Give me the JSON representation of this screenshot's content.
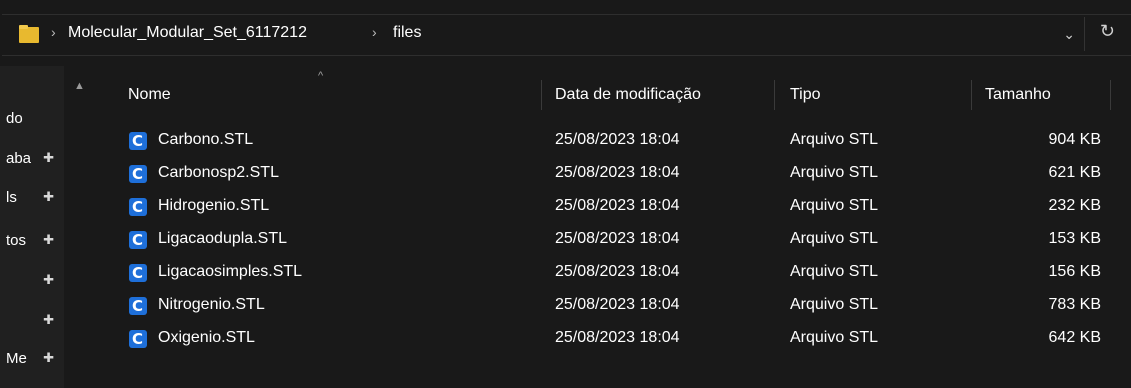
{
  "address_bar": {
    "crumbs": [
      "Molecular_Modular_Set_6117212",
      "files"
    ],
    "separator": "›",
    "dropdown_glyph": "⌄",
    "refresh_glyph": "↻"
  },
  "nav_pane": {
    "items": [
      {
        "label": "do",
        "pinned": false
      },
      {
        "label": "aba",
        "pinned": true
      },
      {
        "label": "ls",
        "pinned": true
      },
      {
        "label": "tos",
        "pinned": true
      },
      {
        "label": "",
        "pinned": true
      },
      {
        "label": "",
        "pinned": true
      },
      {
        "label": "Me",
        "pinned": true
      }
    ],
    "pin_glyph": "✚"
  },
  "columns": {
    "name": "Nome",
    "date": "Data de modificação",
    "type": "Tipo",
    "size": "Tamanho",
    "sort_glyph": "^"
  },
  "files": [
    {
      "name": "Carbono.STL",
      "date": "25/08/2023 18:04",
      "type": "Arquivo STL",
      "size": "904 KB"
    },
    {
      "name": "Carbonosp2.STL",
      "date": "25/08/2023 18:04",
      "type": "Arquivo STL",
      "size": "621 KB"
    },
    {
      "name": "Hidrogenio.STL",
      "date": "25/08/2023 18:04",
      "type": "Arquivo STL",
      "size": "232 KB"
    },
    {
      "name": "Ligacaodupla.STL",
      "date": "25/08/2023 18:04",
      "type": "Arquivo STL",
      "size": "153 KB"
    },
    {
      "name": "Ligacaosimples.STL",
      "date": "25/08/2023 18:04",
      "type": "Arquivo STL",
      "size": "156 KB"
    },
    {
      "name": "Nitrogenio.STL",
      "date": "25/08/2023 18:04",
      "type": "Arquivo STL",
      "size": "783 KB"
    },
    {
      "name": "Oxigenio.STL",
      "date": "25/08/2023 18:04",
      "type": "Arquivo STL",
      "size": "642 KB"
    }
  ],
  "file_icon": {
    "name": "stl-file-icon",
    "glyph": "C",
    "color": "#1e6fd9"
  },
  "colors": {
    "background": "#191919",
    "nav_background": "#202020",
    "folder": "#e8b92f"
  }
}
